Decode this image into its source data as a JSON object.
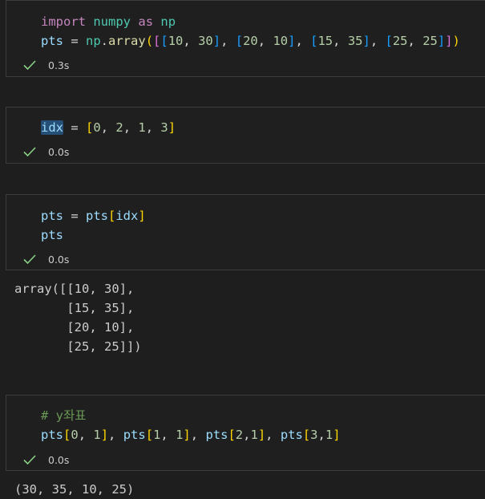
{
  "cells": [
    {
      "lines": [
        [
          {
            "t": "import",
            "c": "kw"
          },
          {
            "t": " "
          },
          {
            "t": "numpy",
            "c": "mod"
          },
          {
            "t": " "
          },
          {
            "t": "as",
            "c": "kw"
          },
          {
            "t": " "
          },
          {
            "t": "np",
            "c": "mod"
          }
        ],
        [
          {
            "t": "pts",
            "c": "var"
          },
          {
            "t": " = "
          },
          {
            "t": "np",
            "c": "mod"
          },
          {
            "t": "."
          },
          {
            "t": "array",
            "c": "fn"
          },
          {
            "t": "(",
            "c": "p1"
          },
          {
            "t": "[",
            "c": "p2"
          },
          {
            "t": "[",
            "c": "p3"
          },
          {
            "t": "10",
            "c": "num"
          },
          {
            "t": ", "
          },
          {
            "t": "30",
            "c": "num"
          },
          {
            "t": "]",
            "c": "p3"
          },
          {
            "t": ", "
          },
          {
            "t": "[",
            "c": "p3"
          },
          {
            "t": "20",
            "c": "num"
          },
          {
            "t": ", "
          },
          {
            "t": "10",
            "c": "num"
          },
          {
            "t": "]",
            "c": "p3"
          },
          {
            "t": ", "
          },
          {
            "t": "[",
            "c": "p3"
          },
          {
            "t": "15",
            "c": "num"
          },
          {
            "t": ", "
          },
          {
            "t": "35",
            "c": "num"
          },
          {
            "t": "]",
            "c": "p3"
          },
          {
            "t": ", "
          },
          {
            "t": "[",
            "c": "p3"
          },
          {
            "t": "25",
            "c": "num"
          },
          {
            "t": ", "
          },
          {
            "t": "25",
            "c": "num"
          },
          {
            "t": "]",
            "c": "p3"
          },
          {
            "t": "]",
            "c": "p2"
          },
          {
            "t": ")",
            "c": "p1"
          }
        ]
      ],
      "time": "0.3s"
    },
    {
      "lines": [
        [
          {
            "t": "idx",
            "c": "var hl"
          },
          {
            "t": " = "
          },
          {
            "t": "[",
            "c": "p1"
          },
          {
            "t": "0",
            "c": "num"
          },
          {
            "t": ", "
          },
          {
            "t": "2",
            "c": "num"
          },
          {
            "t": ", "
          },
          {
            "t": "1",
            "c": "num"
          },
          {
            "t": ", "
          },
          {
            "t": "3",
            "c": "num"
          },
          {
            "t": "]",
            "c": "p1"
          }
        ]
      ],
      "time": "0.0s"
    },
    {
      "lines": [
        [
          {
            "t": "pts",
            "c": "var"
          },
          {
            "t": " = "
          },
          {
            "t": "pts",
            "c": "var"
          },
          {
            "t": "[",
            "c": "p1"
          },
          {
            "t": "idx",
            "c": "var"
          },
          {
            "t": "]",
            "c": "p1"
          }
        ],
        [
          {
            "t": "pts",
            "c": "var"
          }
        ]
      ],
      "time": "0.0s"
    },
    {
      "lines": [
        [
          {
            "t": "# y좌표",
            "c": "cm"
          }
        ],
        [
          {
            "t": "pts",
            "c": "var"
          },
          {
            "t": "[",
            "c": "p1"
          },
          {
            "t": "0",
            "c": "num"
          },
          {
            "t": ", "
          },
          {
            "t": "1",
            "c": "num"
          },
          {
            "t": "]",
            "c": "p1"
          },
          {
            "t": ", "
          },
          {
            "t": "pts",
            "c": "var"
          },
          {
            "t": "[",
            "c": "p1"
          },
          {
            "t": "1",
            "c": "num"
          },
          {
            "t": ", "
          },
          {
            "t": "1",
            "c": "num"
          },
          {
            "t": "]",
            "c": "p1"
          },
          {
            "t": ", "
          },
          {
            "t": "pts",
            "c": "var"
          },
          {
            "t": "[",
            "c": "p1"
          },
          {
            "t": "2",
            "c": "num"
          },
          {
            "t": ","
          },
          {
            "t": "1",
            "c": "num"
          },
          {
            "t": "]",
            "c": "p1"
          },
          {
            "t": ", "
          },
          {
            "t": "pts",
            "c": "var"
          },
          {
            "t": "[",
            "c": "p1"
          },
          {
            "t": "3",
            "c": "num"
          },
          {
            "t": ","
          },
          {
            "t": "1",
            "c": "num"
          },
          {
            "t": "]",
            "c": "p1"
          }
        ]
      ],
      "time": "0.0s"
    }
  ],
  "outputs": {
    "cell3": "array([[10, 30],\n       [15, 35],\n       [20, 10],\n       [25, 25]])",
    "cell4": "(30, 35, 10, 25)"
  },
  "colors": {
    "check": "#89d185"
  }
}
